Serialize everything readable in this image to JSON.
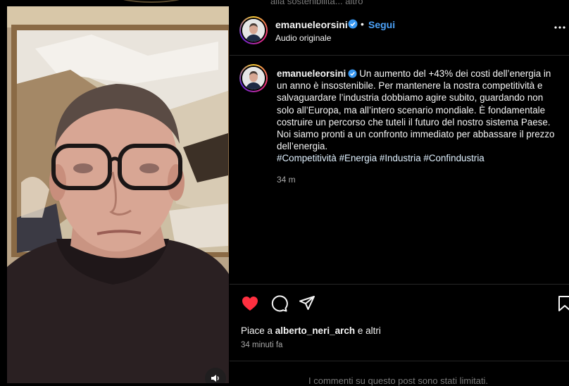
{
  "background": {
    "overlay_text": "alla sostenibilità... altro"
  },
  "post": {
    "username": "emanueleorsini",
    "separator": "•",
    "follow_label": "Segui",
    "audio_label": "Audio originale",
    "caption": {
      "text": "Un aumento del +43% dei costi dell’energia in un anno è insostenibile. Per mantenere la nostra competitività e salvaguardare l’industria dobbiamo agire subito, guardando non solo all’Europa, ma all’intero scenario mondiale. È fondamentale costruire un percorso che tuteli il futuro del nostro sistema Paese. Noi siamo pronti a un confronto immediato per abbassare il prezzo dell’energia.",
      "hashtags": "#Competitività #Energia #Industria #Confindustria",
      "time": "34 m"
    },
    "likes": {
      "prefix": "Piace a",
      "user": "alberto_neri_arch",
      "suffix": "e altri"
    },
    "posted_ago": "34 minuti fa",
    "comments_limited": "I commenti su questo post sono stati limitati."
  },
  "colors": {
    "accent": "#4ca2f8",
    "like_red": "#ff3040",
    "verified": "#3897f0",
    "background": "#000000"
  },
  "icons": [
    "heart-icon",
    "comment-icon",
    "share-icon",
    "bookmark-icon",
    "more-options-icon",
    "verified-badge-icon",
    "volume-icon"
  ]
}
